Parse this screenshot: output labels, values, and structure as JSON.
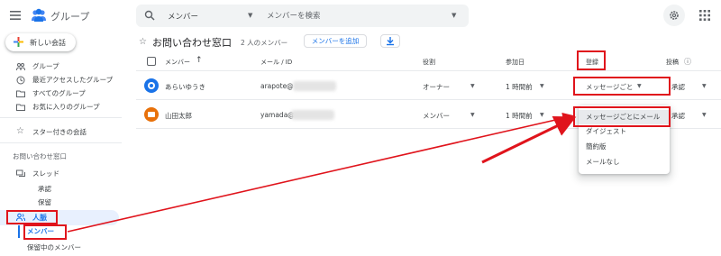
{
  "header": {
    "app_title": "グループ",
    "search_scope": "メンバー",
    "search_placeholder": "メンバーを検索",
    "icons": [
      "menu-icon",
      "groups-logo-icon",
      "search-icon",
      "chevron-down-icon",
      "settings-icon",
      "apps-icon"
    ]
  },
  "sidebar": {
    "new_conversation": "新しい会話",
    "items": [
      {
        "label": "グループ",
        "icon": "groups-icon"
      },
      {
        "label": "最近アクセスしたグループ",
        "icon": "clock-icon"
      },
      {
        "label": "すべてのグループ",
        "icon": "folder-icon"
      },
      {
        "label": "お気に入りのグループ",
        "icon": "folder-icon"
      }
    ],
    "starred": {
      "label": "スター付きの会話",
      "icon": "star-icon"
    },
    "section_title": "お問い合わせ窓口",
    "thread": {
      "label": "スレッド",
      "icon": "thread-icon"
    },
    "thread_sub": [
      "承認",
      "保留"
    ],
    "people": {
      "label": "人脈",
      "icon": "people-icon"
    },
    "people_sub": [
      "メンバー",
      "保留中のメンバー"
    ]
  },
  "main": {
    "title": "お問い合わせ窓口",
    "member_count": "2 人のメンバー",
    "add_member": "メンバーを追加",
    "columns": {
      "member": "メンバー",
      "email": "メール / ID",
      "role": "役割",
      "joined": "参加日",
      "subscription": "登録",
      "posting": "投稿"
    },
    "rows": [
      {
        "name": "あらいゆうき",
        "email": "arapote@",
        "role": "オーナー",
        "joined": "1 時間前",
        "subscription": "メッセージごと",
        "posting": "承認",
        "avatar_color": "#1a73e8"
      },
      {
        "name": "山田太郎",
        "email": "yamada@",
        "role": "メンバー",
        "joined": "1 時間前",
        "subscription": "",
        "posting": "承認",
        "avatar_color": "#e8710a"
      }
    ],
    "dropdown_options": [
      "メッセージごとにメール",
      "ダイジェスト",
      "簡約版",
      "メールなし"
    ],
    "selected_option": "メッセージごとにメール"
  },
  "colors": {
    "accent": "#1a73e8",
    "highlight": "#e0141c",
    "selection_bg": "#e8f0fe"
  }
}
